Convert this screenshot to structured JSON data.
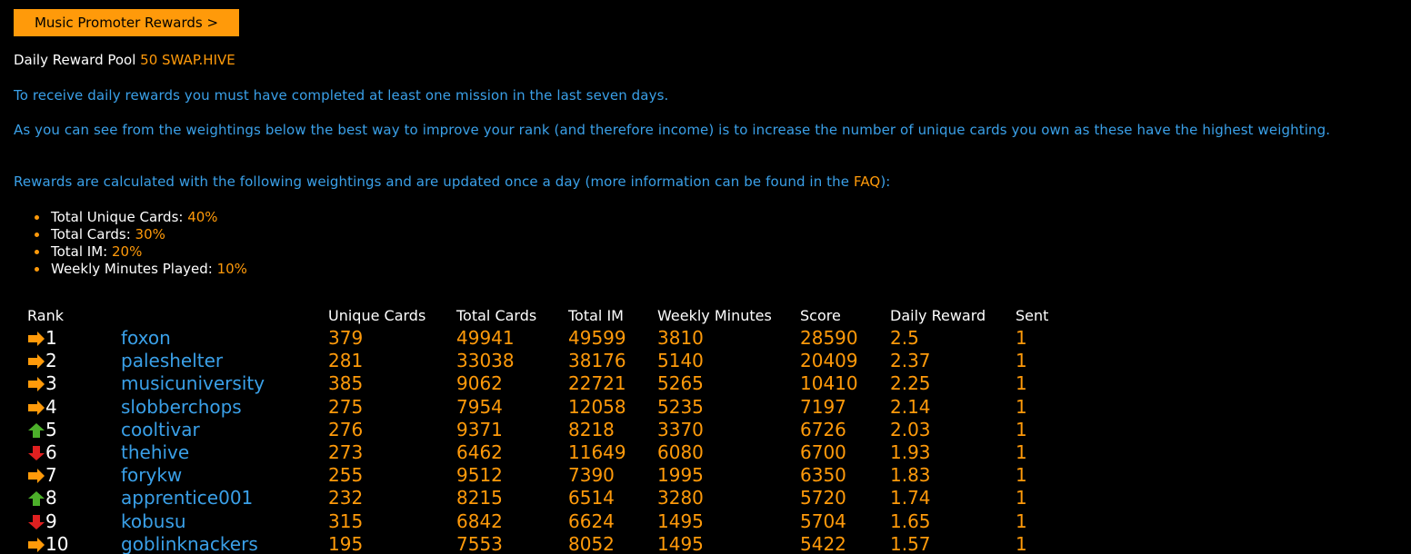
{
  "promo_button": "Music Promoter Rewards >",
  "pool": {
    "label": "Daily Reward Pool",
    "amount": "50 SWAP.HIVE"
  },
  "info": {
    "line1": "To receive daily rewards you must have completed at least one mission in the last seven days.",
    "line2": "As you can see from the weightings below the best way to improve your rank (and therefore income) is to increase the number of unique cards you own as these have the highest weighting.",
    "line3_pre": "Rewards are calculated with the following weightings and are updated once a day (more information can be found in the ",
    "faq": "FAQ",
    "line3_post": "):"
  },
  "weightings": [
    {
      "label": "Total Unique Cards:",
      "pct": "40%"
    },
    {
      "label": "Total Cards:",
      "pct": "30%"
    },
    {
      "label": "Total IM:",
      "pct": "20%"
    },
    {
      "label": "Weekly Minutes Played:",
      "pct": "10%"
    }
  ],
  "table": {
    "headers": {
      "rank": "Rank",
      "unique": "Unique Cards",
      "total": "Total Cards",
      "im": "Total IM",
      "week": "Weekly Minutes",
      "score": "Score",
      "reward": "Daily Reward",
      "sent": "Sent"
    },
    "rows": [
      {
        "trend": "same",
        "rank": "1",
        "user": "foxon",
        "unique": "379",
        "total": "49941",
        "im": "49599",
        "week": "3810",
        "score": "28590",
        "reward": "2.5",
        "sent": "1"
      },
      {
        "trend": "same",
        "rank": "2",
        "user": "paleshelter",
        "unique": "281",
        "total": "33038",
        "im": "38176",
        "week": "5140",
        "score": "20409",
        "reward": "2.37",
        "sent": "1"
      },
      {
        "trend": "same",
        "rank": "3",
        "user": "musicuniversity",
        "unique": "385",
        "total": "9062",
        "im": "22721",
        "week": "5265",
        "score": "10410",
        "reward": "2.25",
        "sent": "1"
      },
      {
        "trend": "same",
        "rank": "4",
        "user": "slobberchops",
        "unique": "275",
        "total": "7954",
        "im": "12058",
        "week": "5235",
        "score": "7197",
        "reward": "2.14",
        "sent": "1"
      },
      {
        "trend": "up",
        "rank": "5",
        "user": "cooltivar",
        "unique": "276",
        "total": "9371",
        "im": "8218",
        "week": "3370",
        "score": "6726",
        "reward": "2.03",
        "sent": "1"
      },
      {
        "trend": "down",
        "rank": "6",
        "user": "thehive",
        "unique": "273",
        "total": "6462",
        "im": "11649",
        "week": "6080",
        "score": "6700",
        "reward": "1.93",
        "sent": "1"
      },
      {
        "trend": "same",
        "rank": "7",
        "user": "forykw",
        "unique": "255",
        "total": "9512",
        "im": "7390",
        "week": "1995",
        "score": "6350",
        "reward": "1.83",
        "sent": "1"
      },
      {
        "trend": "up",
        "rank": "8",
        "user": "apprentice001",
        "unique": "232",
        "total": "8215",
        "im": "6514",
        "week": "3280",
        "score": "5720",
        "reward": "1.74",
        "sent": "1"
      },
      {
        "trend": "down",
        "rank": "9",
        "user": "kobusu",
        "unique": "315",
        "total": "6842",
        "im": "6624",
        "week": "1495",
        "score": "5704",
        "reward": "1.65",
        "sent": "1"
      },
      {
        "trend": "same",
        "rank": "10",
        "user": "goblinknackers",
        "unique": "195",
        "total": "7553",
        "im": "8052",
        "week": "1495",
        "score": "5422",
        "reward": "1.57",
        "sent": "1"
      }
    ]
  },
  "colors": {
    "accent": "#ff9a0a",
    "link": "#3aa0e8",
    "up": "#4caf2a",
    "down": "#e02020"
  },
  "icons": {
    "same": "arrow-right-icon",
    "up": "arrow-up-icon",
    "down": "arrow-down-icon"
  }
}
